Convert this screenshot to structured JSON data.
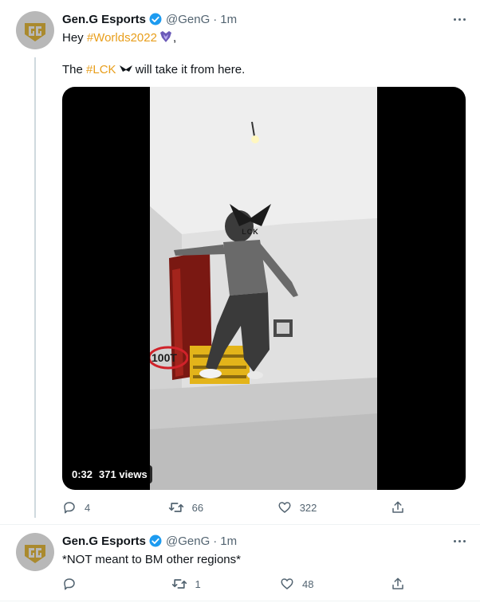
{
  "tweets": [
    {
      "author": "Gen.G Esports",
      "handle": "@GenG",
      "separator": "·",
      "time": "1m",
      "line1_prefix": "Hey ",
      "line1_hashtag": "#Worlds2022",
      "line1_suffix": ",",
      "line2_prefix": "The ",
      "line2_hashtag": "#LCK",
      "line2_suffix": " will take it from here.",
      "video": {
        "duration": "0:32",
        "views": "371 views",
        "overlay_logo_text": "LCK",
        "sign_text": "100T"
      },
      "replies": "4",
      "retweets": "66",
      "likes": "322"
    },
    {
      "author": "Gen.G Esports",
      "handle": "@GenG",
      "separator": "·",
      "time": "1m",
      "text": "*NOT meant to BM other regions*",
      "replies": "",
      "retweets": "1",
      "likes": "48"
    }
  ],
  "colors": {
    "hashtag": "#e89e1b",
    "verified": "#1d9bf0",
    "text": "#0f1419",
    "secondary": "#536471",
    "avatar_logo": "#aa8a2e"
  }
}
